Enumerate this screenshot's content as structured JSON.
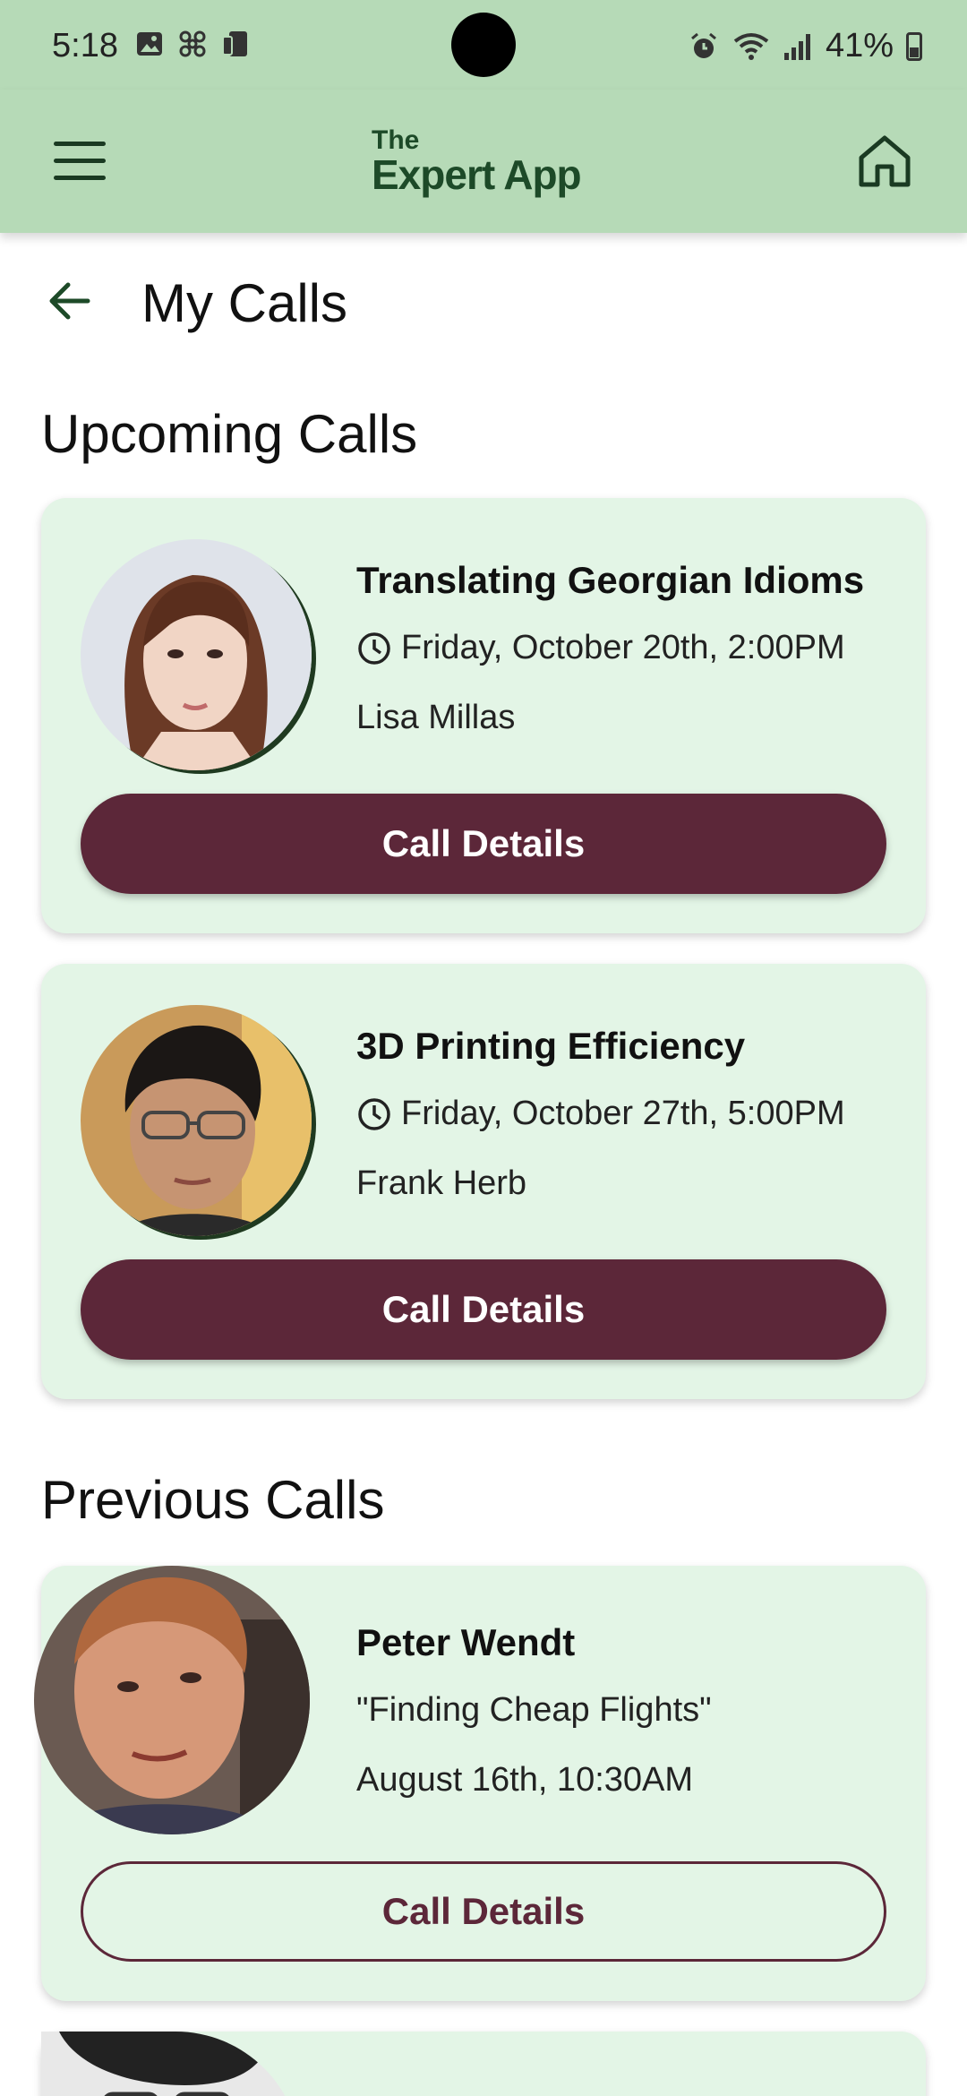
{
  "status_bar": {
    "time": "5:18",
    "battery": "41%"
  },
  "app_bar": {
    "logo_line1": "The",
    "logo_line2": "Expert App"
  },
  "page": {
    "title": "My Calls"
  },
  "upcoming": {
    "heading": "Upcoming Calls",
    "calls": [
      {
        "title": "Translating Georgian Idioms",
        "datetime": "Friday, October 20th, 2:00PM",
        "expert": "Lisa Millas",
        "button": "Call Details"
      },
      {
        "title": "3D Printing Efficiency",
        "datetime": "Friday, October 27th, 5:00PM",
        "expert": "Frank Herb",
        "button": "Call Details"
      }
    ]
  },
  "previous": {
    "heading": "Previous Calls",
    "calls": [
      {
        "expert": "Peter Wendt",
        "topic": "\"Finding Cheap Flights\"",
        "datetime": "August 16th, 10:30AM",
        "button": "Call Details"
      }
    ]
  },
  "colors": {
    "app_bar": "#b6dab7",
    "card": "#e3f5e6",
    "accent": "#5c2739",
    "logo": "#1d4a28"
  }
}
